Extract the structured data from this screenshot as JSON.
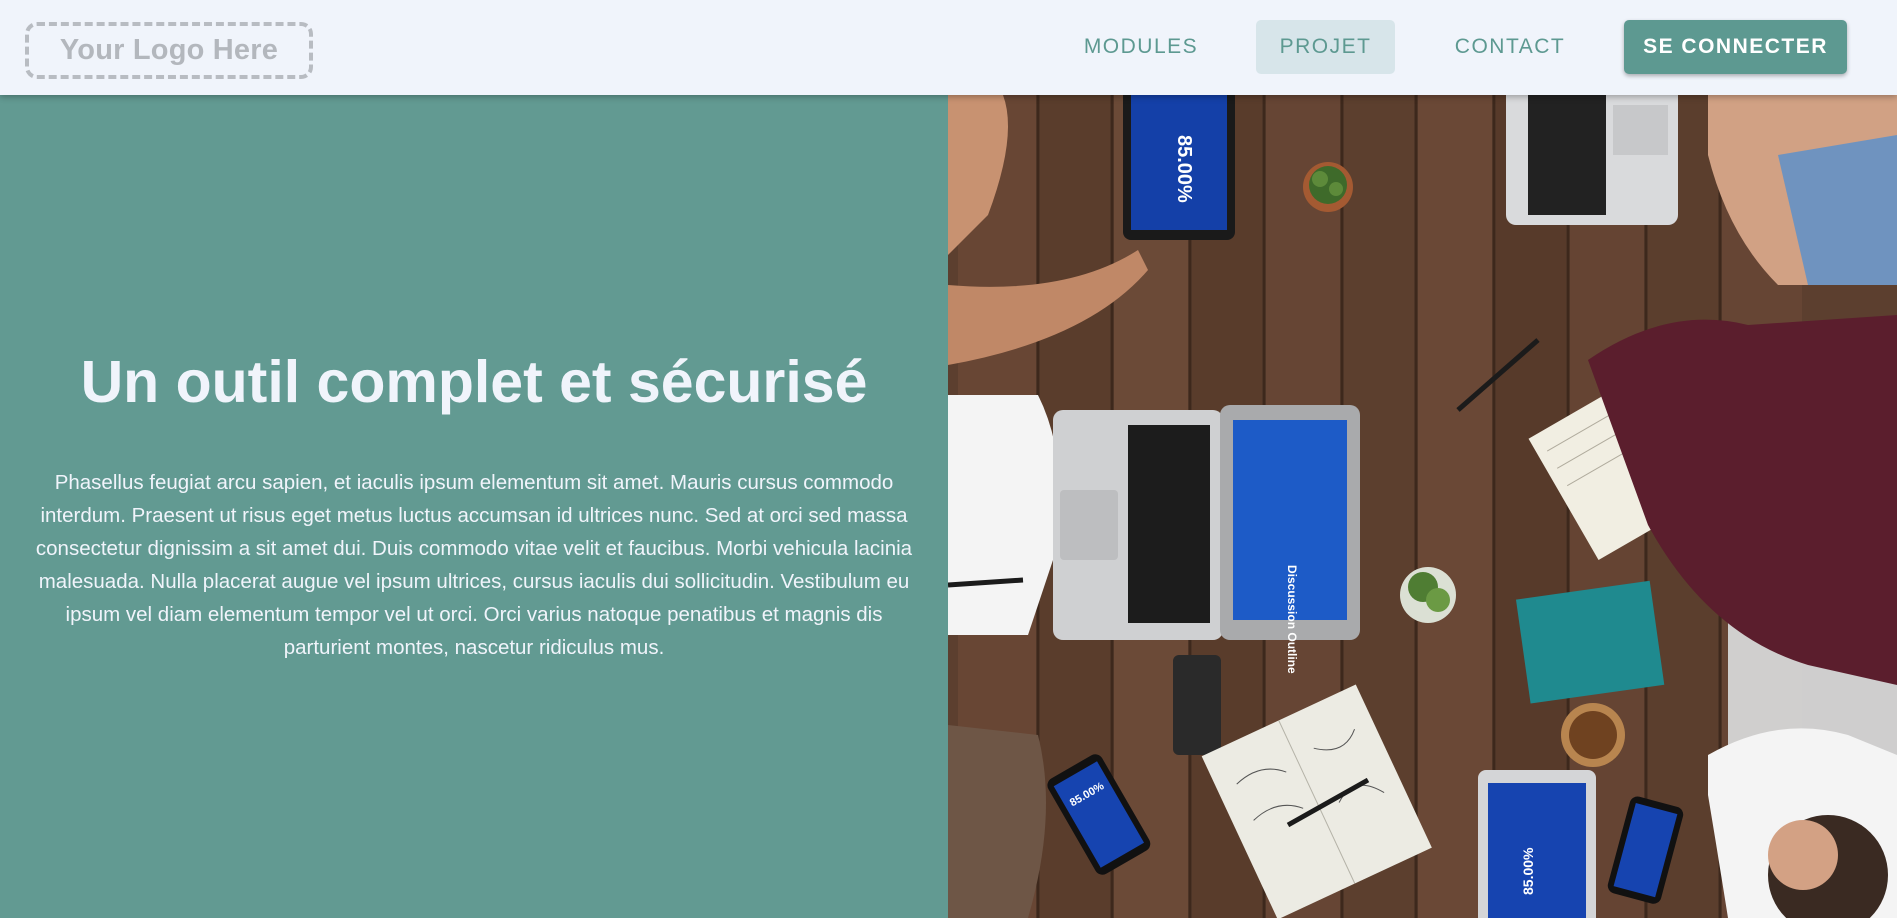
{
  "header": {
    "logo_text": "Your Logo Here",
    "nav": {
      "modules": "MODULES",
      "projet": "PROJET",
      "contact": "CONTACT",
      "login": "SE CONNECTER"
    },
    "active_tab": "PROJET"
  },
  "hero": {
    "title": "Un outil complet et sécurisé",
    "paragraph": "Phasellus feugiat arcu sapien, et iaculis ipsum elementum sit amet. Mauris cursus commodo interdum. Praesent ut risus eget metus luctus accumsan id ultrices nunc. Sed at orci sed massa consectetur dignissim a sit amet dui. Duis commodo vitae velit et faucibus. Morbi vehicula lacinia malesuada. Nulla placerat augue vel ipsum ultrices, cursus iaculis dui sollicitudin. Vestibulum eu ipsum vel diam elementum tempor vel ut orci. Orci varius natoque penatibus et magnis dis parturient montes, nascetur ridiculus mus."
  },
  "photo": {
    "screen_texts": {
      "tablet_top": "85.00%",
      "laptop_screen": "Discussion Outline",
      "phone": "85.00%",
      "tablet_bottom": "85.00%"
    }
  },
  "colors": {
    "accent": "#629a92",
    "button": "#5d9991",
    "active_tab_bg": "#d7e5ea",
    "header_bg": "#f0f4fb",
    "text_light": "#f0f4fb"
  }
}
